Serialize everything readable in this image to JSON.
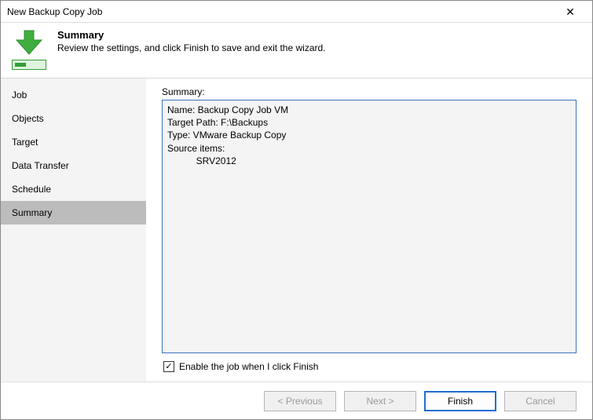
{
  "window": {
    "title": "New Backup Copy Job"
  },
  "header": {
    "title": "Summary",
    "subtitle": "Review the settings, and click Finish to save and exit the wizard."
  },
  "sidebar": {
    "items": [
      "Job",
      "Objects",
      "Target",
      "Data Transfer",
      "Schedule",
      "Summary"
    ],
    "selected_index": 5
  },
  "content": {
    "summary_label": "Summary:",
    "details": {
      "name_label": "Name",
      "name_value": "Backup Copy Job VM",
      "target_path_label": "Target Path",
      "target_path_value": "F:\\Backups",
      "type_label": "Type",
      "type_value": "VMware Backup Copy",
      "source_items_label": "Source items",
      "source_items": [
        "SRV2012"
      ]
    },
    "enable_checkbox": {
      "label": "Enable the job when I click Finish",
      "checked": true
    }
  },
  "footer": {
    "previous": "< Previous",
    "next": "Next >",
    "finish": "Finish",
    "cancel": "Cancel",
    "previous_enabled": false,
    "next_enabled": false,
    "cancel_enabled": false
  }
}
